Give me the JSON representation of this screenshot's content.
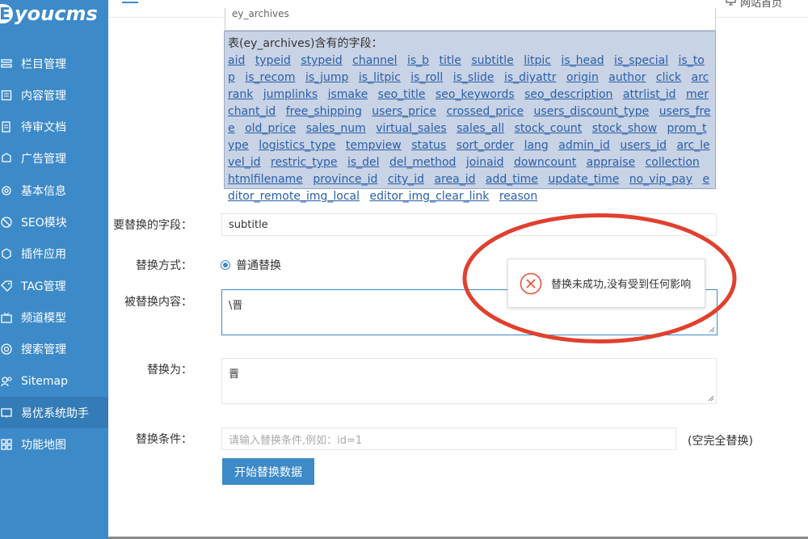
{
  "brand": {
    "logo_mark": "E",
    "logo_text": "youcms",
    "color": "#3d8ac9"
  },
  "header": {
    "site_home_label": "网站首页"
  },
  "sidebar": {
    "items": [
      {
        "label": "栏目管理",
        "icon": "columns-icon"
      },
      {
        "label": "内容管理",
        "icon": "content-icon"
      },
      {
        "label": "待审文档",
        "icon": "review-doc-icon"
      },
      {
        "label": "广告管理",
        "icon": "ad-icon"
      },
      {
        "label": "基本信息",
        "icon": "settings-icon"
      },
      {
        "label": "SEO模块",
        "icon": "seo-icon"
      },
      {
        "label": "插件应用",
        "icon": "plugin-icon"
      },
      {
        "label": "TAG管理",
        "icon": "tag-icon"
      },
      {
        "label": "频道模型",
        "icon": "channel-icon"
      },
      {
        "label": "搜索管理",
        "icon": "search-icon"
      },
      {
        "label": "Sitemap",
        "icon": "sitemap-icon"
      },
      {
        "label": "易优系统助手",
        "icon": "assistant-icon",
        "active": true
      },
      {
        "label": "功能地图",
        "icon": "map-icon"
      }
    ]
  },
  "form": {
    "table_select_partial": "ey_archives",
    "fields_title": "表(ey_archives)含有的字段：",
    "fields": [
      "aid",
      "typeid",
      "stypeid",
      "channel",
      "is_b",
      "title",
      "subtitle",
      "litpic",
      "is_head",
      "is_special",
      "is_top",
      "is_recom",
      "is_jump",
      "is_litpic",
      "is_roll",
      "is_slide",
      "is_diyattr",
      "origin",
      "author",
      "click",
      "arcrank",
      "jumplinks",
      "ismake",
      "seo_title",
      "seo_keywords",
      "seo_description",
      "attrlist_id",
      "merchant_id",
      "free_shipping",
      "users_price",
      "crossed_price",
      "users_discount_type",
      "users_free",
      "old_price",
      "sales_num",
      "virtual_sales",
      "sales_all",
      "stock_count",
      "stock_show",
      "prom_type",
      "logistics_type",
      "tempview",
      "status",
      "sort_order",
      "lang",
      "admin_id",
      "users_id",
      "arc_level_id",
      "restric_type",
      "is_del",
      "del_method",
      "joinaid",
      "downcount",
      "appraise",
      "collection",
      "htmlfilename",
      "province_id",
      "city_id",
      "area_id",
      "add_time",
      "update_time",
      "no_vip_pay",
      "editor_remote_img_local",
      "editor_img_clear_link",
      "reason"
    ],
    "field_label": "要替换的字段：",
    "field_value": "subtitle",
    "mode_label": "替换方式：",
    "mode_option": "普通替换",
    "search_label": "被替换内容：",
    "search_value": "\\晋",
    "replace_label": "替换为：",
    "replace_value": "晋",
    "condition_label": "替换条件：",
    "condition_placeholder": "请输入替换条件,例如：id=1",
    "condition_hint": "(空完全替换)",
    "submit_label": "开始替换数据"
  },
  "toast": {
    "message": "替换未成功,没有受到任何影响",
    "icon": "error-circle-icon",
    "color": "#e8553e"
  },
  "annotation": {
    "color": "#e0412e"
  }
}
